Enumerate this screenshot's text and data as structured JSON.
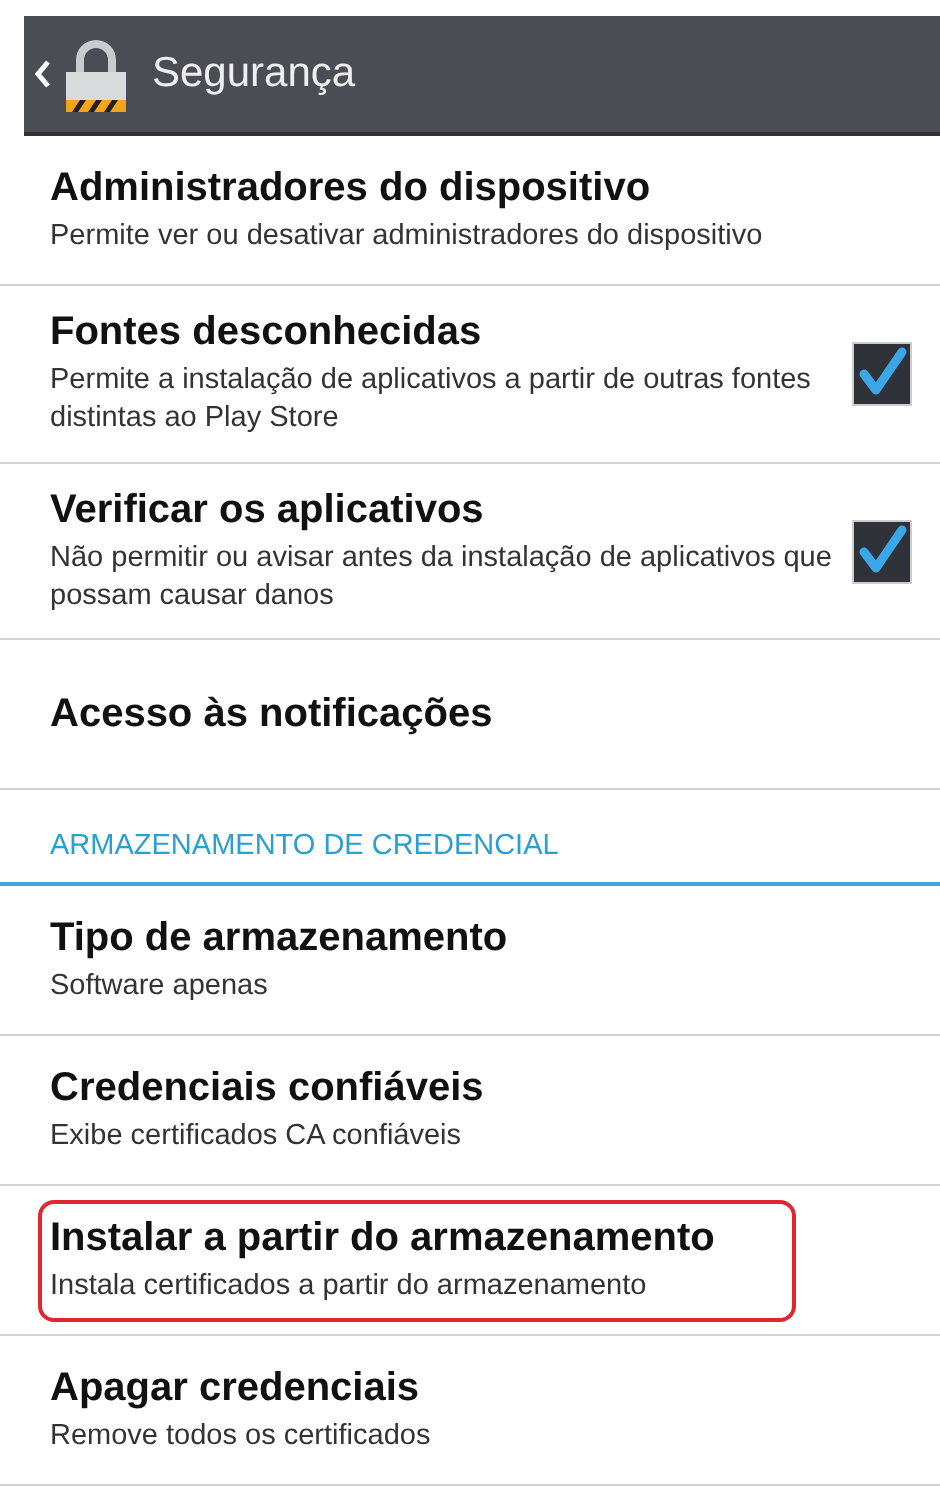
{
  "header": {
    "title": "Segurança"
  },
  "items": [
    {
      "kind": "item",
      "title": "Administradores do dispositivo",
      "subtitle": "Permite ver ou desativar administradores do dispositivo"
    },
    {
      "kind": "check",
      "title": "Fontes desconhecidas",
      "subtitle": "Permite a instalação de aplicativos a partir de outras fontes distintas ao Play Store",
      "checked": true
    },
    {
      "kind": "check",
      "title": "Verificar os aplicativos",
      "subtitle": "Não permitir ou avisar antes da instalação de aplicativos que possam causar danos",
      "checked": true
    },
    {
      "kind": "item",
      "title": "Acesso às notificações"
    },
    {
      "kind": "section",
      "title": "ARMAZENAMENTO DE CREDENCIAL"
    },
    {
      "kind": "item",
      "title": "Tipo de armazenamento",
      "subtitle": "Software apenas"
    },
    {
      "kind": "item",
      "title": "Credenciais confiáveis",
      "subtitle": "Exibe certificados CA confiáveis"
    },
    {
      "kind": "item",
      "title": "Instalar a partir do armazenamento",
      "subtitle": "Instala certificados a partir do armazenamento",
      "highlighted": true
    },
    {
      "kind": "item",
      "title": "Apagar credenciais",
      "subtitle": "Remove todos os certificados"
    }
  ]
}
